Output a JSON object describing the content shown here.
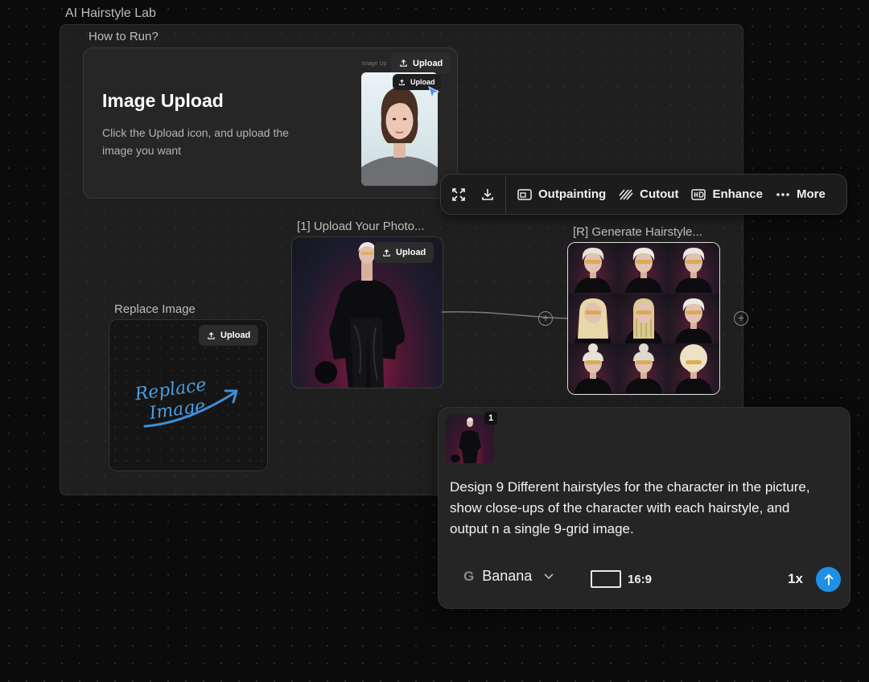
{
  "group": {
    "title": "AI Hairstyle Lab"
  },
  "howto": {
    "title": "How to Run?",
    "heading": "Image Upload",
    "description": "Click the Upload icon, and upload the  image you want",
    "tiny_label": "Image Up",
    "upload_label": "Upload",
    "thumb_upload_label": "Upload"
  },
  "toolbar": {
    "items": [
      {
        "label": "Outpainting",
        "icon": "outpainting-icon"
      },
      {
        "label": "Cutout",
        "icon": "cutout-icon"
      },
      {
        "label": "Enhance",
        "icon": "hd-icon"
      },
      {
        "label": "More",
        "icon": "more-icon"
      }
    ],
    "icons": [
      "expand-icon",
      "download-icon"
    ]
  },
  "upload_node": {
    "title": "[1] Upload Your Photo...",
    "upload_label": "Upload"
  },
  "generate_node": {
    "title": "[R] Generate Hairstyle..."
  },
  "replace_node": {
    "title": "Replace Image",
    "upload_label": "Upload",
    "handwriting_line1": "Replace",
    "handwriting_line2": "Image"
  },
  "prompt": {
    "badge": "1",
    "text": "Design 9 Different hairstyles for the character in the picture, show close-ups of the character with each hairstyle, and output n a single 9-grid image.",
    "model_icon": "G",
    "model": "Banana",
    "ratio": "16:9",
    "count": "1x"
  },
  "colors": {
    "accent": "#1e90e8",
    "handwriting": "#4a9ee0",
    "background": "#0b0b0b",
    "group_bg": "#1f1f1f"
  }
}
